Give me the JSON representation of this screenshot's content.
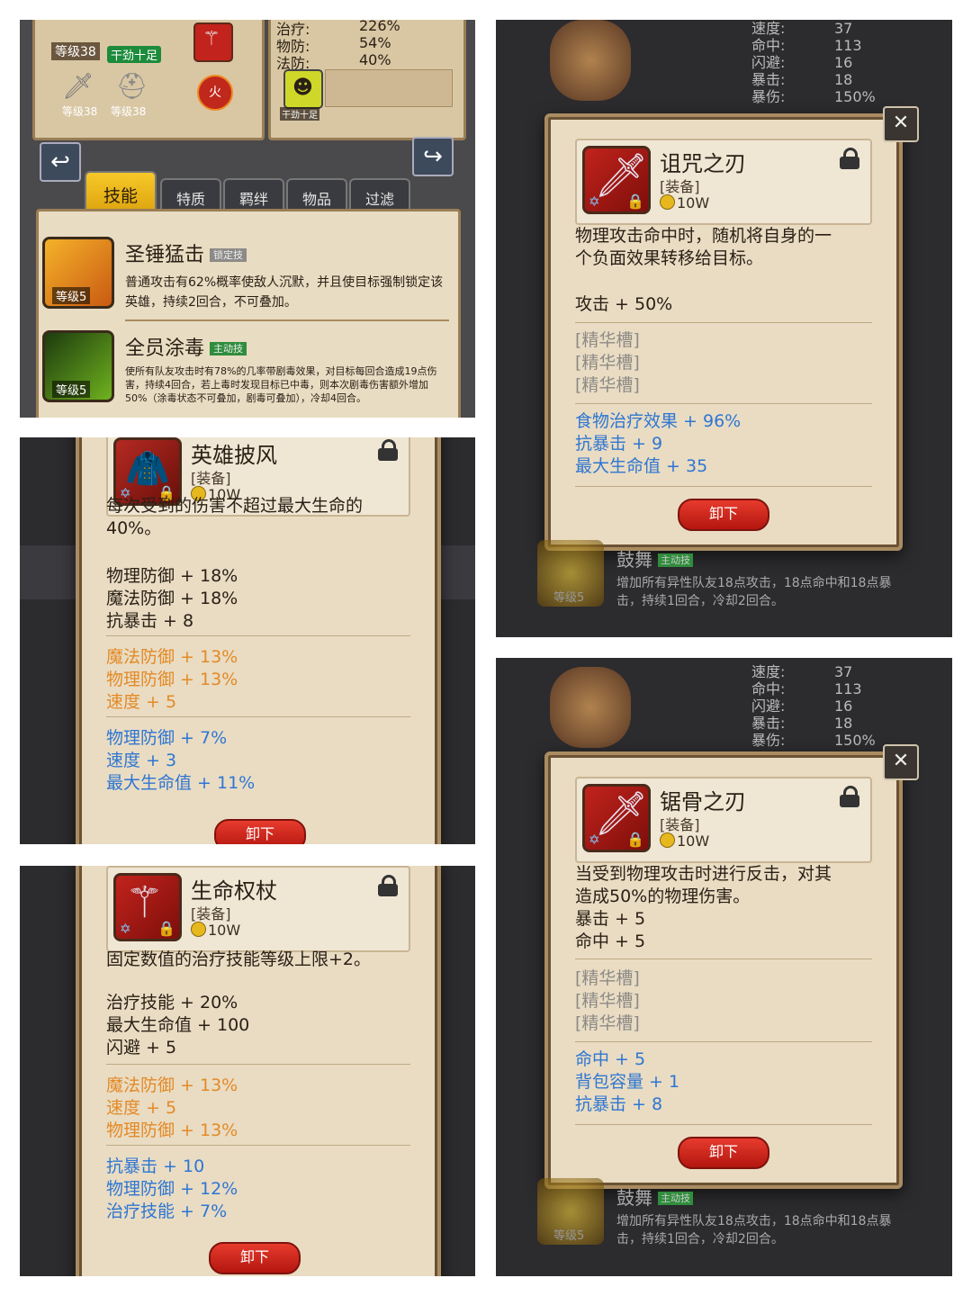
{
  "shot1": {
    "level_label": "等级38",
    "status_badge": "干劲十足",
    "gear_levels": [
      "等级38",
      "等级38"
    ],
    "fire_label": "火",
    "pet_label": "干劲十足",
    "stats": [
      {
        "label": "治疗:",
        "value": "226%"
      },
      {
        "label": "物防:",
        "value": "54%"
      },
      {
        "label": "法防:",
        "value": "40%"
      }
    ],
    "tabs": [
      "技能",
      "特质",
      "羁绊",
      "物品",
      "过滤"
    ],
    "skills": [
      {
        "name": "圣锤猛击",
        "type": "锁定技",
        "level": "等级5",
        "desc": "普通攻击有62%概率使敌人沉默，并且使目标强制锁定该英雄，持续2回合，不可叠加。"
      },
      {
        "name": "全员涂毒",
        "type": "主动技",
        "level": "等级5",
        "desc": "使所有队友攻击时有78%的几率带剧毒效果，对目标每回合造成19点伤害，持续4回合，若上毒时发现目标已中毒，则本次剧毒伤害额外增加50%（涂毒状态不可叠加，剧毒可叠加），冷却4回合。"
      }
    ]
  },
  "bg_stats": [
    {
      "label": "速度:",
      "value": "37"
    },
    {
      "label": "命中:",
      "value": "113"
    },
    {
      "label": "闪避:",
      "value": "16"
    },
    {
      "label": "暴击:",
      "value": "18"
    },
    {
      "label": "暴伤:",
      "value": "150%"
    }
  ],
  "bg_skill": {
    "name": "鼓舞",
    "type": "主动技",
    "level": "等级5",
    "desc": "增加所有异性队友18点攻击，18点命中和18点暴击，持续1回合，冷却2回合。"
  },
  "items": {
    "cloak": {
      "name": "英雄披风",
      "tag": "[装备]",
      "price": "10W",
      "desc": "每次受到的伤害不超过最大生命的40%。",
      "base": [
        "物理防御 + 18%",
        "魔法防御 + 18%",
        "抗暴击 + 8"
      ],
      "orange": [
        "魔法防御 + 13%",
        "物理防御 + 13%",
        "速度 + 5"
      ],
      "blue": [
        "物理防御 + 7%",
        "速度 + 3",
        "最大生命值 + 11%"
      ],
      "button": "卸下"
    },
    "staff": {
      "name": "生命权杖",
      "tag": "[装备]",
      "price": "10W",
      "desc": "固定数值的治疗技能等级上限+2。",
      "base": [
        "治疗技能 + 20%",
        "最大生命值 + 100",
        "闪避 + 5"
      ],
      "orange": [
        "魔法防御 + 13%",
        "速度 + 5",
        "物理防御 + 13%"
      ],
      "blue": [
        "抗暴击 + 10",
        "物理防御 + 12%",
        "治疗技能 + 7%"
      ],
      "button": "卸下"
    },
    "curse": {
      "name": "诅咒之刃",
      "tag": "[装备]",
      "price": "10W",
      "desc": "物理攻击命中时，随机将自身的一\n个负面效果转移给目标。",
      "base": [
        "攻击 + 50%"
      ],
      "slots": [
        "[精华槽]",
        "[精华槽]",
        "[精华槽]"
      ],
      "blue": [
        "食物治疗效果 + 96%",
        "抗暴击 + 9",
        "最大生命值 + 35"
      ],
      "button": "卸下"
    },
    "saw": {
      "name": "锯骨之刃",
      "tag": "[装备]",
      "price": "10W",
      "desc": "当受到物理攻击时进行反击，对其\n造成50%的物理伤害。",
      "base": [
        "暴击 + 5",
        "命中 + 5"
      ],
      "slots": [
        "[精华槽]",
        "[精华槽]",
        "[精华槽]"
      ],
      "blue": [
        "命中 + 5",
        "背包容量 + 1",
        "抗暴击 + 8"
      ],
      "button": "卸下"
    }
  },
  "colors": {
    "orange": "#e38a27",
    "blue": "#2f76d2",
    "gray": "#8d8a86",
    "button": "#d9241a"
  }
}
